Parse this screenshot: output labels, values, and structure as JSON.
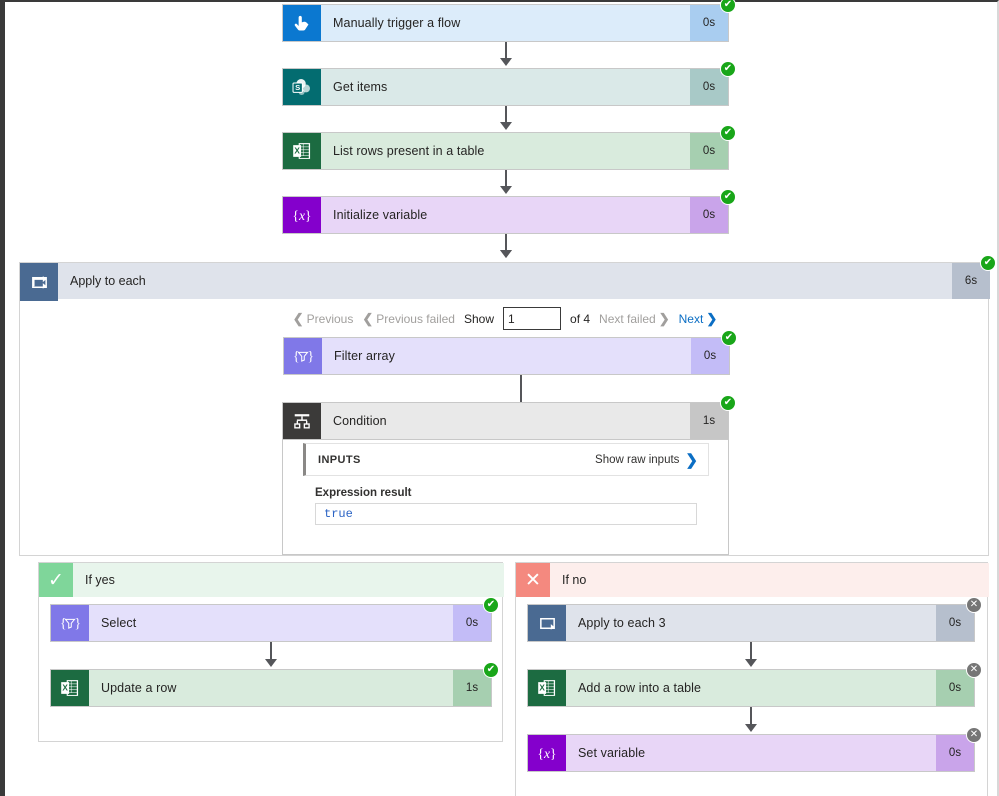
{
  "flow": {
    "steps": [
      {
        "id": "manually-trigger-a-flow",
        "label": "Manually trigger a flow",
        "duration": "0s",
        "status": "succeeded",
        "icon": "tap-trigger-icon",
        "theme": "c-blue",
        "tile": "t-trigger"
      },
      {
        "id": "get-items",
        "label": "Get items",
        "duration": "0s",
        "status": "succeeded",
        "icon": "sharepoint-icon",
        "theme": "c-teal",
        "tile": "t-sp"
      },
      {
        "id": "list-rows-present-in-a-table",
        "label": "List rows present in a table",
        "duration": "0s",
        "status": "succeeded",
        "icon": "excel-icon",
        "theme": "c-green",
        "tile": "t-excel"
      },
      {
        "id": "initialize-variable",
        "label": "Initialize variable",
        "duration": "0s",
        "status": "succeeded",
        "icon": "variable-icon",
        "theme": "c-purple",
        "tile": "t-var"
      }
    ]
  },
  "scope": {
    "label": "Apply to each",
    "duration": "6s",
    "status": "succeeded",
    "icon": "loop-icon"
  },
  "pager": {
    "previous": "Previous",
    "previous_failed": "Previous failed",
    "show_label": "Show",
    "page_value": "1",
    "of_label": "of 4",
    "next_failed": "Next failed",
    "next": "Next"
  },
  "filter_array": {
    "label": "Filter array",
    "duration": "0s",
    "status": "succeeded",
    "icon": "filter-array-icon"
  },
  "condition": {
    "label": "Condition",
    "duration": "1s",
    "status": "succeeded",
    "icon": "condition-icon",
    "inputs_title": "INPUTS",
    "show_raw_inputs": "Show raw inputs",
    "expression_result_label": "Expression result",
    "expression_result_value": "true"
  },
  "branches": {
    "yes": {
      "label": "If yes",
      "mark": "✓",
      "steps": [
        {
          "id": "select",
          "label": "Select",
          "duration": "0s",
          "status": "succeeded",
          "icon": "select-icon",
          "theme": "c-lpurple",
          "tile": "t-select"
        },
        {
          "id": "update-a-row",
          "label": "Update a row",
          "duration": "1s",
          "status": "succeeded",
          "icon": "excel-icon",
          "theme": "c-green",
          "tile": "t-excel"
        }
      ]
    },
    "no": {
      "label": "If no",
      "mark": "✕",
      "steps": [
        {
          "id": "apply-to-each-3",
          "label": "Apply to each 3",
          "duration": "0s",
          "status": "skipped",
          "icon": "loop-icon",
          "theme": "c-gray",
          "tile": "t-loop"
        },
        {
          "id": "add-a-row-into-a-table",
          "label": "Add a row into a table",
          "duration": "0s",
          "status": "skipped",
          "icon": "excel-icon",
          "theme": "c-green",
          "tile": "t-excel"
        },
        {
          "id": "set-variable",
          "label": "Set variable",
          "duration": "0s",
          "status": "skipped",
          "icon": "variable-icon",
          "theme": "c-purple",
          "tile": "t-var"
        }
      ]
    }
  },
  "colors": {
    "success": "#19a619",
    "skipped": "#767676",
    "link": "#0b6ec4",
    "disabled_text": "#a19f9d",
    "connector": "#55565a"
  },
  "badge_glyphs": {
    "succeeded": "✔",
    "skipped": "✕"
  }
}
